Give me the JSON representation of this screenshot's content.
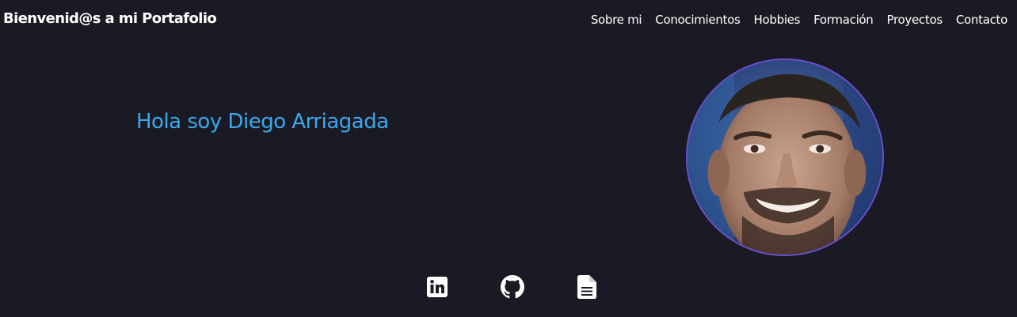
{
  "navbar": {
    "brand": "Bienvenid@s a mi Portafolio",
    "links": [
      {
        "label": "Sobre mi"
      },
      {
        "label": "Conocimientos"
      },
      {
        "label": "Hobbies"
      },
      {
        "label": "Formación"
      },
      {
        "label": "Proyectos"
      },
      {
        "label": "Contacto"
      }
    ]
  },
  "hero": {
    "greeting": "Hola soy Diego Arriagada"
  },
  "social": [
    {
      "icon": "linkedin-icon"
    },
    {
      "icon": "github-icon"
    },
    {
      "icon": "document-icon"
    }
  ],
  "colors": {
    "background": "#1a1a24",
    "accent": "#3ba8ee",
    "avatar_border": "#6b4fcf",
    "text": "#ffffff"
  }
}
